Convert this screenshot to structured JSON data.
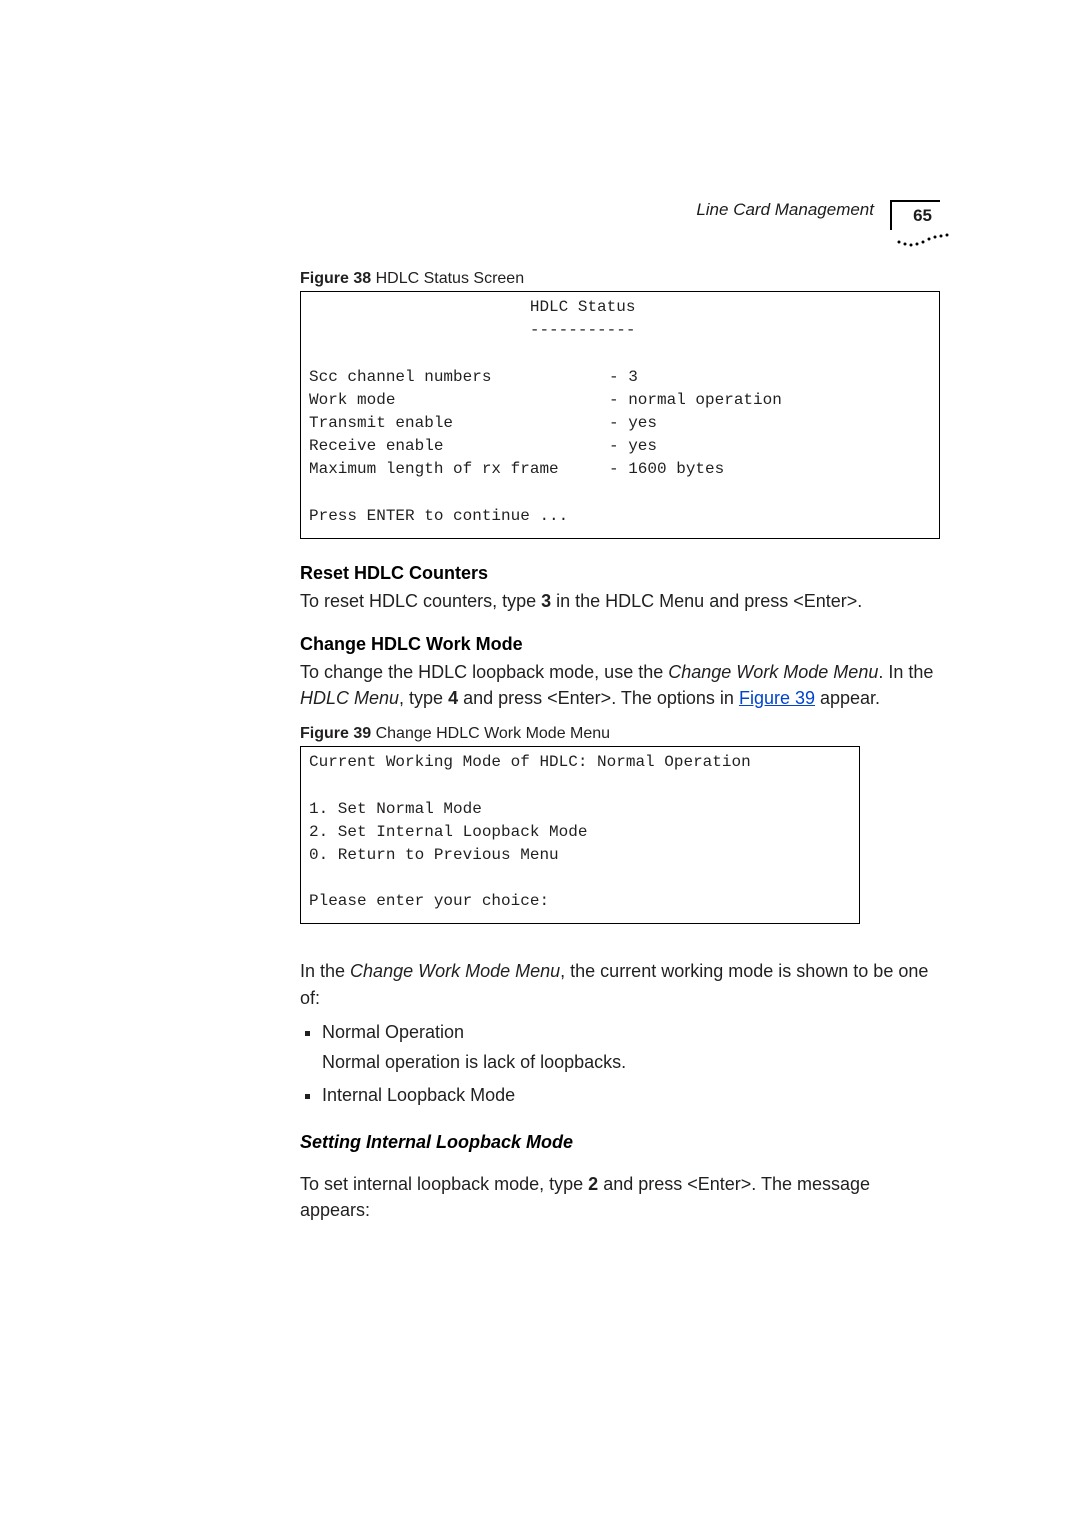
{
  "header": {
    "section_title": "Line Card Management",
    "page_number": "65"
  },
  "figure38": {
    "caption_bold": "Figure 38",
    "caption_rest": "   HDLC Status Screen",
    "line1": "                       HDLC Status",
    "line2": "                       -----------",
    "blank1": "",
    "row1_l": "Scc channel numbers",
    "row1_r": "- 3",
    "row2_l": "Work mode",
    "row2_r": "- normal operation",
    "row3_l": "Transmit enable",
    "row3_r": "- yes",
    "row4_l": "Receive enable",
    "row4_r": "- yes",
    "row5_l": "Maximum length of rx frame",
    "row5_r": "- 1600 bytes",
    "blank2": "",
    "press_line": "Press ENTER to continue ..."
  },
  "reset_section": {
    "heading": "Reset HDLC Counters",
    "para_pre": "To reset HDLC counters, type ",
    "para_bold": "3",
    "para_post": " in the HDLC Menu and press <Enter>."
  },
  "change_section": {
    "heading": "Change HDLC Work Mode",
    "p1_pre": "To change the HDLC loopback mode, use the ",
    "p1_ital": "Change Work Mode Menu",
    "p1_post": ". In the ",
    "p1_ital2": "HDLC Menu",
    "p1_mid": ", type ",
    "p1_bold": "4",
    "p1_after": " and press <Enter>. The options in ",
    "p1_link": "Figure 39",
    "p1_end": " appear."
  },
  "figure39": {
    "caption_bold": "Figure 39",
    "caption_rest": "   Change HDLC Work Mode Menu",
    "line1": "Current Working Mode of HDLC: Normal Operation",
    "blank1": "",
    "line2": "1. Set Normal Mode",
    "line3": "2. Set Internal Loopback Mode",
    "line4": "0. Return to Previous Menu",
    "blank2": "",
    "line5": "Please enter your choice:"
  },
  "after_fig39": {
    "p_pre": "In the ",
    "p_ital": "Change Work Mode Menu",
    "p_post": ", the current working mode is shown to be one of:",
    "bullet1": "Normal Operation",
    "bullet1_sub": "Normal operation is lack of loopbacks.",
    "bullet2": "Internal Loopback Mode"
  },
  "setting_internal": {
    "heading": "Setting Internal Loopback Mode",
    "p_pre": "To set internal loopback mode, type ",
    "p_bold": "2",
    "p_post": " and press <Enter>. The message appears:"
  }
}
